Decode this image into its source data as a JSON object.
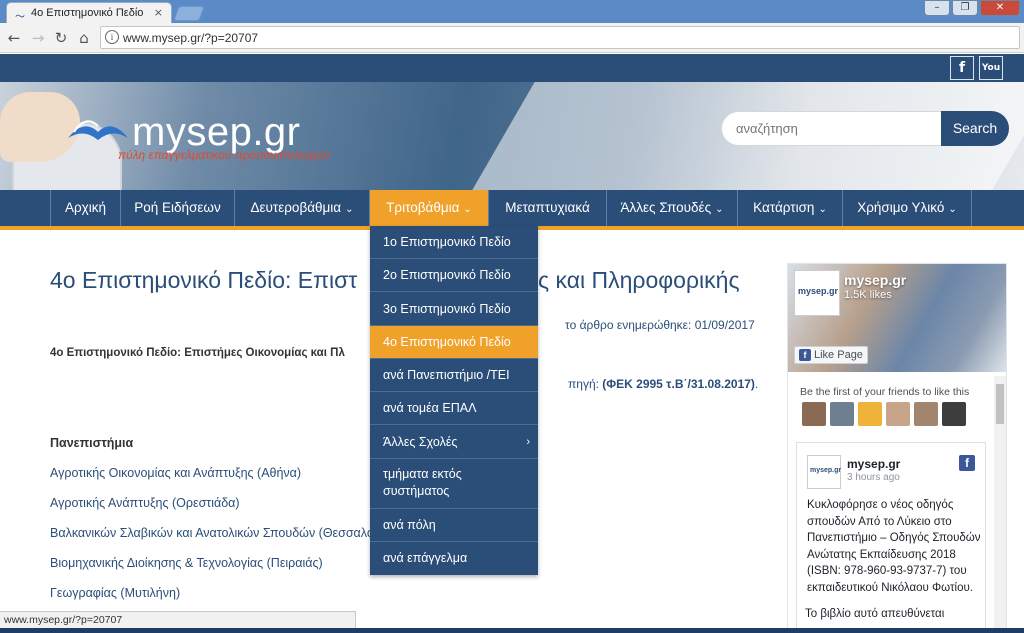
{
  "browser": {
    "tab_title": "4ο Επιστημονικό Πεδίο",
    "tab_close": "×",
    "url": "www.mysep.gr/?p=20707",
    "back_icon": "arrow-left",
    "forward_icon": "arrow-right",
    "reload_icon": "reload",
    "home_icon": "home",
    "info_icon": "info",
    "window_buttons": [
      "–",
      "❐",
      "✕"
    ]
  },
  "header": {
    "social": [
      "f",
      "You"
    ],
    "logo_text": "mysep.gr",
    "logo_tagline": "πύλη επαγγελματικού προσανατολισμού",
    "search_placeholder": "αναζήτηση",
    "search_button": "Search"
  },
  "nav": {
    "items": [
      {
        "label": "Αρχική",
        "chevron": ""
      },
      {
        "label": "Ροή Ειδήσεων",
        "chevron": ""
      },
      {
        "label": "Δευτεροβάθμια",
        "chevron": "⌄"
      },
      {
        "label": "Τριτοβάθμια",
        "chevron": "⌄"
      },
      {
        "label": "Μεταπτυχιακά",
        "chevron": ""
      },
      {
        "label": "Άλλες Σπουδές",
        "chevron": "⌄"
      },
      {
        "label": "Κατάρτιση",
        "chevron": "⌄"
      },
      {
        "label": "Χρήσιμο Υλικό",
        "chevron": "⌄"
      }
    ],
    "active_index": 3,
    "accent_color": "#f0a12a",
    "nav_color": "#2b4e78"
  },
  "dropdown": {
    "items": [
      {
        "label": "1ο Επιστημονικό Πεδίο",
        "sublabel": ""
      },
      {
        "label": "2ο Επιστημονικό Πεδίο",
        "sublabel": ""
      },
      {
        "label": "3ο Επιστημονικό Πεδίο",
        "sublabel": ""
      },
      {
        "label": "4ο Επιστημονικό Πεδίο",
        "sublabel": ""
      },
      {
        "label": "ανά Πανεπιστήμιο /ΤΕΙ",
        "sublabel": ""
      },
      {
        "label": "ανά τομέα ΕΠΑΛ",
        "sublabel": ""
      },
      {
        "label": "Άλλες Σχολές",
        "sublabel": "",
        "chevron": "›"
      },
      {
        "label": "τμήματα εκτός",
        "sublabel": "συστήματος"
      },
      {
        "label": "ανά πόλη",
        "sublabel": ""
      },
      {
        "label": "ανά επάγγελμα",
        "sublabel": ""
      }
    ],
    "active_index": 3
  },
  "article": {
    "title_left": "4ο Επιστημονικό Πεδίο: Επιστ",
    "title_right": "ς και Πληροφορικής",
    "updated": "το άρθρο ενημερώθηκε: 01/09/2017",
    "subtitle": "4ο Επιστημονικό Πεδίο: Επιστήμες Οικονομίας και Πλ",
    "source_prefix": "πηγή: ",
    "source_bold": "(ΦΕΚ 2995 τ.Β΄/31.08.2017)",
    "source_suffix": ".",
    "section": "Πανεπιστήμια",
    "universities": [
      "Αγροτικής Οικονομίας και Ανάπτυξης (Αθήνα)",
      "Αγροτικής Ανάπτυξης (Ορεστιάδα)",
      "Βαλκανικών Σλαβικών και Ανατολικών Σπουδών (Θεσσαλο",
      "Βιομηχανικής Διοίκησης & Τεχνολογίας (Πειραιάς)",
      "Γεωγραφίας (Μυτιλήνη)"
    ]
  },
  "facebook": {
    "page_name": "mysep.gr",
    "likes": "1.5K likes",
    "like_button": "Like Page",
    "friends_text": "Be the first of your friends to like this",
    "thumb_logo": "mysep.gr",
    "post": {
      "name": "mysep.gr",
      "time": "3 hours ago",
      "text": "Κυκλοφόρησε ο νέος οδηγός σπουδών Από το Λύκειο στο Πανεπιστήμιο – Οδηγός Σπουδών Ανώτατης Εκπαίδευσης 2018 (ISBN: 978-960-93-9737-7) του εκπαιδευτικού Νικόλαου Φωτίου.",
      "text2": "Το βιβλίο αυτό απευθύνεται"
    }
  },
  "statusbar": {
    "url": "www.mysep.gr/?p=20707"
  }
}
